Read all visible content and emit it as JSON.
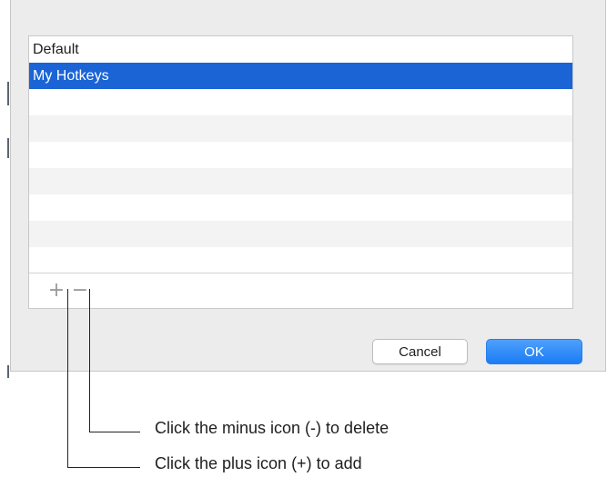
{
  "hotkey_list": {
    "items": [
      {
        "label": "Default",
        "selected": false
      },
      {
        "label": "My Hotkeys",
        "selected": true
      }
    ]
  },
  "toolbar": {
    "add_icon": "plus-icon",
    "add_glyph": "+",
    "remove_icon": "minus-icon",
    "remove_glyph": "−"
  },
  "buttons": {
    "cancel_label": "Cancel",
    "ok_label": "OK"
  },
  "callouts": {
    "minus": "Click the minus icon (-) to delete",
    "plus": "Click the plus icon (+) to add"
  },
  "colors": {
    "selection": "#1a64d6",
    "ok_button": "#1b7cf5",
    "dialog_bg": "#ececec"
  }
}
